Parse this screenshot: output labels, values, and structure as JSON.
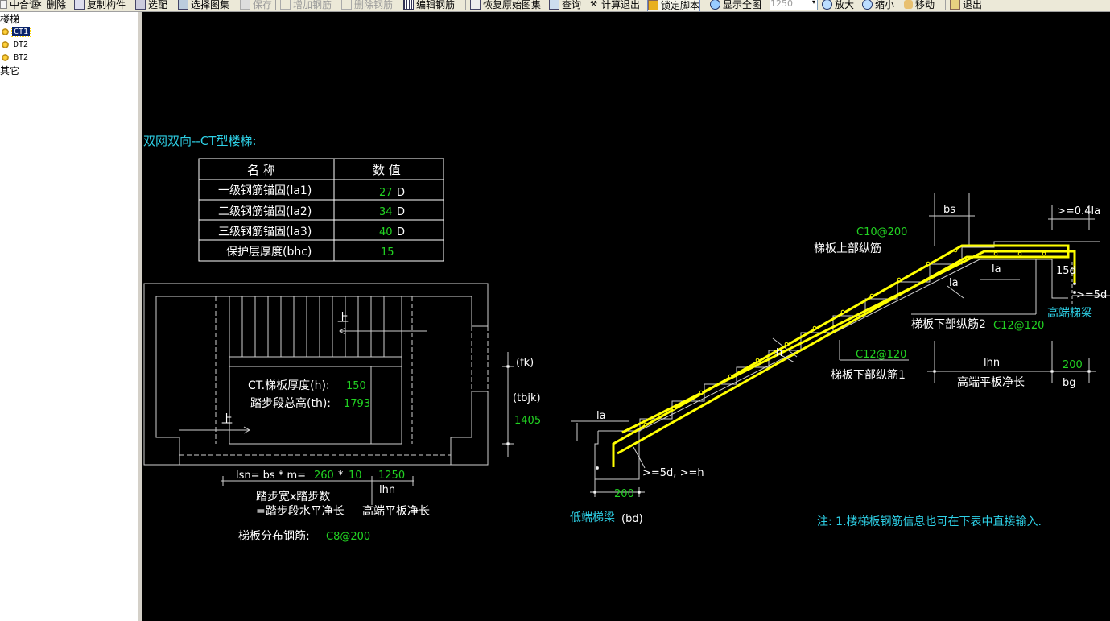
{
  "toolbar": {
    "items": [
      "中合诓",
      "删除",
      "复制构件",
      "选配",
      "选择图集",
      "保存",
      "增加钢筋",
      "删除钢筋",
      "编辑钢筋",
      "恢复原始图集",
      "查询",
      "计算退出",
      "锁定脚本",
      "显示全图",
      "放大",
      "缩小",
      "移动",
      "退出"
    ],
    "zoom_value": "1250"
  },
  "tree": {
    "root": "楼梯",
    "children": [
      "CT1",
      "DT2",
      "BT2"
    ],
    "other": "其它"
  },
  "drawing": {
    "title": "双网双向--CT型楼梯:",
    "table": {
      "headers": [
        "名  称",
        "数  值"
      ],
      "rows": [
        {
          "name": "一级钢筋锚固(la1)",
          "value": "27",
          "unit": "D"
        },
        {
          "name": "二级钢筋锚固(la2)",
          "value": "34",
          "unit": "D"
        },
        {
          "name": "三级钢筋锚固(la3)",
          "value": "40",
          "unit": "D"
        },
        {
          "name": "保护层厚度(bhc)",
          "value": "15",
          "unit": ""
        }
      ]
    },
    "plan": {
      "up1": "上",
      "up2": "上",
      "thickness_label": "CT.梯板厚度(h):",
      "thickness_value": "150",
      "height_label": "踏步段总高(th):",
      "height_value": "1793",
      "fk": "(fk)",
      "tbjk": "(tbjk)",
      "tbjk_value": "1405",
      "lsn_label": "lsn= bs * m=",
      "bs_value": "260",
      "times": "*",
      "m_value": "10",
      "lhn_value": "1250",
      "lhn_label": "lhn",
      "step_text": "踏步宽x踏步数",
      "step_text2": "=踏步段水平净长",
      "high_plate": "高端平板净长",
      "dist_label": "梯板分布钢筋:",
      "dist_value": "C8@200"
    },
    "section": {
      "bs": "bs",
      "top_bar": "C10@200",
      "top_bar_label": "梯板上部纵筋",
      "ge04la": ">=0.4la",
      "la_a": "la",
      "la_b": "la",
      "d15": "15d",
      "ge5d": ">=5d",
      "high_beam": "高端梯梁",
      "bottom2_label": "梯板下部纵筋2",
      "bottom2_bar": "C12@120",
      "h": "h",
      "bottom1_bar": "C12@120",
      "bottom1_label": "梯板下部纵筋1",
      "lhn": "lhn",
      "bg_value": "200",
      "high_plate": "高端平板净长",
      "bg": "bg",
      "la_low": "la",
      "ge5d_h": ">=5d, >=h",
      "bd_value": "200",
      "low_beam": "低端梯梁",
      "bd": "(bd)"
    },
    "note": "注: 1.楼梯板钢筋信息也可在下表中直接输入."
  }
}
